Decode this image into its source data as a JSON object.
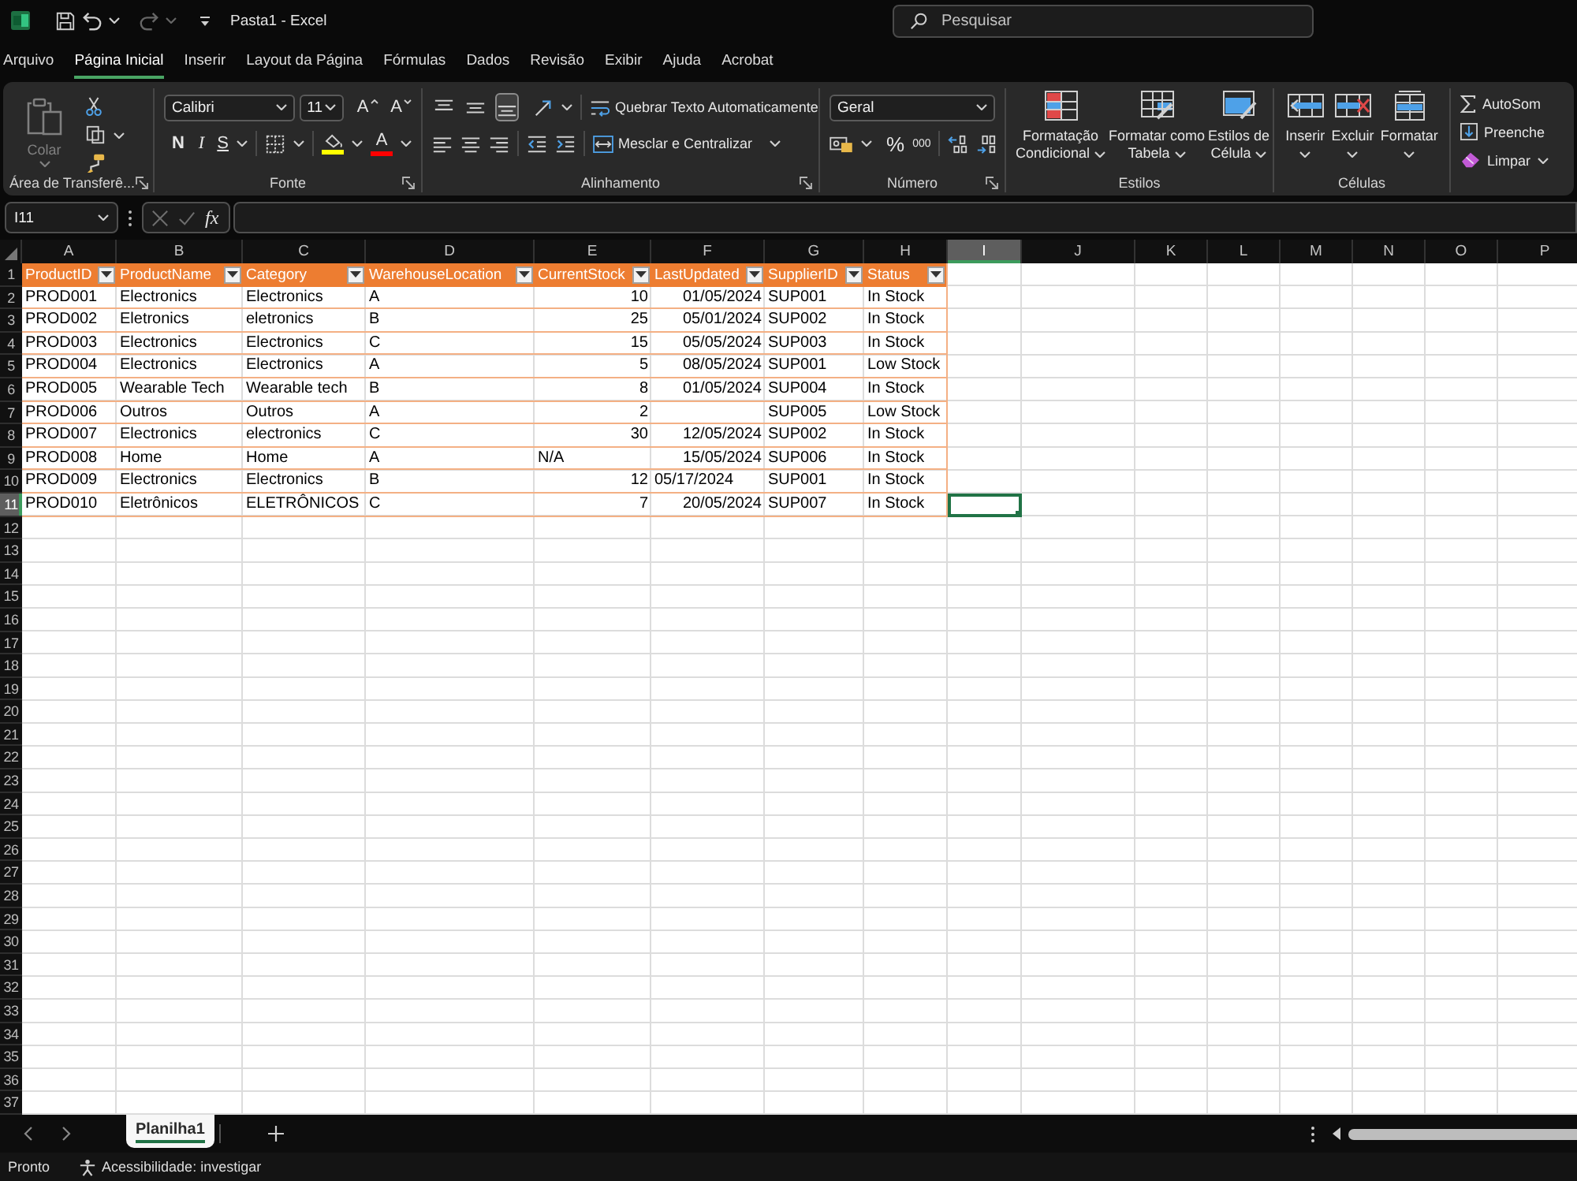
{
  "title_bar": {
    "title": "Pasta1 - Excel",
    "search": {
      "placeholder": "Pesquisar"
    }
  },
  "quick_access": {
    "undo": {
      "disabled": false
    },
    "redo": {
      "disabled": true
    }
  },
  "menu_tabs": [
    {
      "label": "Arquivo",
      "selected": false
    },
    {
      "label": "Página Inicial",
      "selected": true
    },
    {
      "label": "Inserir",
      "selected": false
    },
    {
      "label": "Layout da Página",
      "selected": false
    },
    {
      "label": "Fórmulas",
      "selected": false
    },
    {
      "label": "Dados",
      "selected": false
    },
    {
      "label": "Revisão",
      "selected": false
    },
    {
      "label": "Exibir",
      "selected": false
    },
    {
      "label": "Ajuda",
      "selected": false
    },
    {
      "label": "Acrobat",
      "selected": false
    }
  ],
  "ribbon": {
    "clipboard": {
      "label": "Área de Transferê...",
      "paste": {
        "label": "Colar",
        "disabled": true
      }
    },
    "font": {
      "label": "Fonte",
      "font_name": "Calibri",
      "font_size": "11",
      "grow_font": "A",
      "shrink_font": "A",
      "bold": "N",
      "italic": "I",
      "underline": "S",
      "fill_color": {
        "color": "#ffff00"
      },
      "font_color": {
        "label": "A",
        "color": "#ff0000"
      }
    },
    "alignment": {
      "label": "Alinhamento",
      "vertical_align": [
        {
          "selected": false
        },
        {
          "selected": false
        },
        {
          "selected": true
        }
      ],
      "wrap_text": "Quebrar Texto Automaticamente",
      "merge": "Mesclar e Centralizar"
    },
    "number": {
      "label": "Número",
      "format": "Geral",
      "percent": "%",
      "thousands": "000"
    },
    "styles": {
      "label": "Estilos",
      "buttons": [
        {
          "kind": "conditional",
          "lines": [
            "Formatação",
            "Condicional"
          ]
        },
        {
          "kind": "table",
          "lines": [
            "Formatar como",
            "Tabela"
          ]
        },
        {
          "kind": "cell",
          "lines": [
            "Estilos de",
            "Célula"
          ]
        }
      ]
    },
    "cells": {
      "label": "Células",
      "buttons": [
        {
          "kind": "insert",
          "label": "Inserir"
        },
        {
          "kind": "delete",
          "label": "Excluir"
        },
        {
          "kind": "format",
          "label": "Formatar"
        }
      ]
    },
    "editing": {
      "buttons": [
        {
          "kind": "sum",
          "label": "AutoSom",
          "dropdown": false
        },
        {
          "kind": "fill",
          "label": "Preenche",
          "dropdown": false
        },
        {
          "kind": "clear",
          "label": "Limpar",
          "dropdown": true
        }
      ]
    }
  },
  "formula_bar": {
    "name_box": "I11",
    "insert_function": "fx"
  },
  "sheet": {
    "columns": [
      {
        "label": "A",
        "selected": false
      },
      {
        "label": "B",
        "selected": false
      },
      {
        "label": "C",
        "selected": false
      },
      {
        "label": "D",
        "selected": false
      },
      {
        "label": "E",
        "selected": false
      },
      {
        "label": "F",
        "selected": false
      },
      {
        "label": "G",
        "selected": false
      },
      {
        "label": "H",
        "selected": false
      },
      {
        "label": "I",
        "selected": true
      },
      {
        "label": "J",
        "selected": false
      },
      {
        "label": "K",
        "selected": false
      },
      {
        "label": "L",
        "selected": false
      },
      {
        "label": "M",
        "selected": false
      },
      {
        "label": "N",
        "selected": false
      },
      {
        "label": "O",
        "selected": false
      },
      {
        "label": "P",
        "selected": false
      }
    ],
    "rows": [
      {
        "label": "1",
        "selected": false
      },
      {
        "label": "2",
        "selected": false
      },
      {
        "label": "3",
        "selected": false
      },
      {
        "label": "4",
        "selected": false
      },
      {
        "label": "5",
        "selected": false
      },
      {
        "label": "6",
        "selected": false
      },
      {
        "label": "7",
        "selected": false
      },
      {
        "label": "8",
        "selected": false
      },
      {
        "label": "9",
        "selected": false
      },
      {
        "label": "10",
        "selected": false
      },
      {
        "label": "11",
        "selected": true
      },
      {
        "label": "12",
        "selected": false
      },
      {
        "label": "13",
        "selected": false
      },
      {
        "label": "14",
        "selected": false
      },
      {
        "label": "15",
        "selected": false
      },
      {
        "label": "16",
        "selected": false
      },
      {
        "label": "17",
        "selected": false
      },
      {
        "label": "18",
        "selected": false
      },
      {
        "label": "19",
        "selected": false
      },
      {
        "label": "20",
        "selected": false
      },
      {
        "label": "21",
        "selected": false
      },
      {
        "label": "22",
        "selected": false
      },
      {
        "label": "23",
        "selected": false
      },
      {
        "label": "24",
        "selected": false
      },
      {
        "label": "25",
        "selected": false
      },
      {
        "label": "26",
        "selected": false
      },
      {
        "label": "27",
        "selected": false
      },
      {
        "label": "28",
        "selected": false
      },
      {
        "label": "29",
        "selected": false
      },
      {
        "label": "30",
        "selected": false
      },
      {
        "label": "31",
        "selected": false
      },
      {
        "label": "32",
        "selected": false
      },
      {
        "label": "33",
        "selected": false
      },
      {
        "label": "34",
        "selected": false
      },
      {
        "label": "35",
        "selected": false
      },
      {
        "label": "36",
        "selected": false
      },
      {
        "label": "37",
        "selected": false
      }
    ]
  },
  "table": {
    "columns": [
      "ProductID",
      "ProductName",
      "Category",
      "WarehouseLocation",
      "CurrentStock",
      "LastUpdated",
      "SupplierID",
      "Status"
    ],
    "rows": [
      [
        {
          "value": "PROD001",
          "kind": "text"
        },
        {
          "value": "Electronics",
          "kind": "text"
        },
        {
          "value": "Electronics",
          "kind": "text"
        },
        {
          "value": "A",
          "kind": "text"
        },
        {
          "value": "10",
          "kind": "number"
        },
        {
          "value": "01/05/2024",
          "kind": "number"
        },
        {
          "value": "SUP001",
          "kind": "text"
        },
        {
          "value": "In Stock",
          "kind": "text"
        }
      ],
      [
        {
          "value": "PROD002",
          "kind": "text"
        },
        {
          "value": "Eletronics",
          "kind": "text"
        },
        {
          "value": "eletronics",
          "kind": "text"
        },
        {
          "value": "B",
          "kind": "text"
        },
        {
          "value": "25",
          "kind": "number"
        },
        {
          "value": "05/01/2024",
          "kind": "number"
        },
        {
          "value": "SUP002",
          "kind": "text"
        },
        {
          "value": "In Stock",
          "kind": "text"
        }
      ],
      [
        {
          "value": "PROD003",
          "kind": "text"
        },
        {
          "value": "Electronics",
          "kind": "text"
        },
        {
          "value": "Electronics",
          "kind": "text"
        },
        {
          "value": "C",
          "kind": "text"
        },
        {
          "value": "15",
          "kind": "number"
        },
        {
          "value": "05/05/2024",
          "kind": "number"
        },
        {
          "value": "SUP003",
          "kind": "text"
        },
        {
          "value": "In Stock",
          "kind": "text"
        }
      ],
      [
        {
          "value": "PROD004",
          "kind": "text"
        },
        {
          "value": "Electronics",
          "kind": "text"
        },
        {
          "value": "Electronics",
          "kind": "text"
        },
        {
          "value": "A",
          "kind": "text"
        },
        {
          "value": "5",
          "kind": "number"
        },
        {
          "value": "08/05/2024",
          "kind": "number"
        },
        {
          "value": "SUP001",
          "kind": "text"
        },
        {
          "value": "Low Stock",
          "kind": "text"
        }
      ],
      [
        {
          "value": "PROD005",
          "kind": "text"
        },
        {
          "value": "Wearable Tech",
          "kind": "text"
        },
        {
          "value": "Wearable tech",
          "kind": "text"
        },
        {
          "value": "B",
          "kind": "text"
        },
        {
          "value": "8",
          "kind": "number"
        },
        {
          "value": "01/05/2024",
          "kind": "number"
        },
        {
          "value": "SUP004",
          "kind": "text"
        },
        {
          "value": "In Stock",
          "kind": "text"
        }
      ],
      [
        {
          "value": "PROD006",
          "kind": "text"
        },
        {
          "value": "Outros",
          "kind": "text"
        },
        {
          "value": "Outros",
          "kind": "text"
        },
        {
          "value": "A",
          "kind": "text"
        },
        {
          "value": "2",
          "kind": "number"
        },
        null,
        {
          "value": "SUP005",
          "kind": "text"
        },
        {
          "value": "Low Stock",
          "kind": "text"
        }
      ],
      [
        {
          "value": "PROD007",
          "kind": "text"
        },
        {
          "value": "Electronics",
          "kind": "text"
        },
        {
          "value": "electronics",
          "kind": "text"
        },
        {
          "value": "C",
          "kind": "text"
        },
        {
          "value": "30",
          "kind": "number"
        },
        {
          "value": "12/05/2024",
          "kind": "number"
        },
        {
          "value": "SUP002",
          "kind": "text"
        },
        {
          "value": "In Stock",
          "kind": "text"
        }
      ],
      [
        {
          "value": "PROD008",
          "kind": "text"
        },
        {
          "value": "Home",
          "kind": "text"
        },
        {
          "value": "Home",
          "kind": "text"
        },
        {
          "value": "A",
          "kind": "text"
        },
        {
          "value": "N/A",
          "kind": "text"
        },
        {
          "value": "15/05/2024",
          "kind": "number"
        },
        {
          "value": "SUP006",
          "kind": "text"
        },
        {
          "value": "In Stock",
          "kind": "text"
        }
      ],
      [
        {
          "value": "PROD009",
          "kind": "text"
        },
        {
          "value": "Electronics",
          "kind": "text"
        },
        {
          "value": "Electronics",
          "kind": "text"
        },
        {
          "value": "B",
          "kind": "text"
        },
        {
          "value": "12",
          "kind": "number"
        },
        {
          "value": "05/17/2024",
          "kind": "text"
        },
        {
          "value": "SUP001",
          "kind": "text"
        },
        {
          "value": "In Stock",
          "kind": "text"
        }
      ],
      [
        {
          "value": "PROD010",
          "kind": "text"
        },
        {
          "value": "Eletrônicos",
          "kind": "text"
        },
        {
          "value": "ELETRÔNICOS",
          "kind": "text"
        },
        {
          "value": "C",
          "kind": "text"
        },
        {
          "value": "7",
          "kind": "number"
        },
        {
          "value": "20/05/2024",
          "kind": "number"
        },
        {
          "value": "SUP007",
          "kind": "text"
        },
        {
          "value": "In Stock",
          "kind": "text"
        }
      ]
    ]
  },
  "sheet_tabs": [
    {
      "label": "Planilha1",
      "selected": true
    }
  ],
  "status_bar": {
    "status": "Pronto",
    "accessibility": "Acessibilidade: investigar"
  }
}
